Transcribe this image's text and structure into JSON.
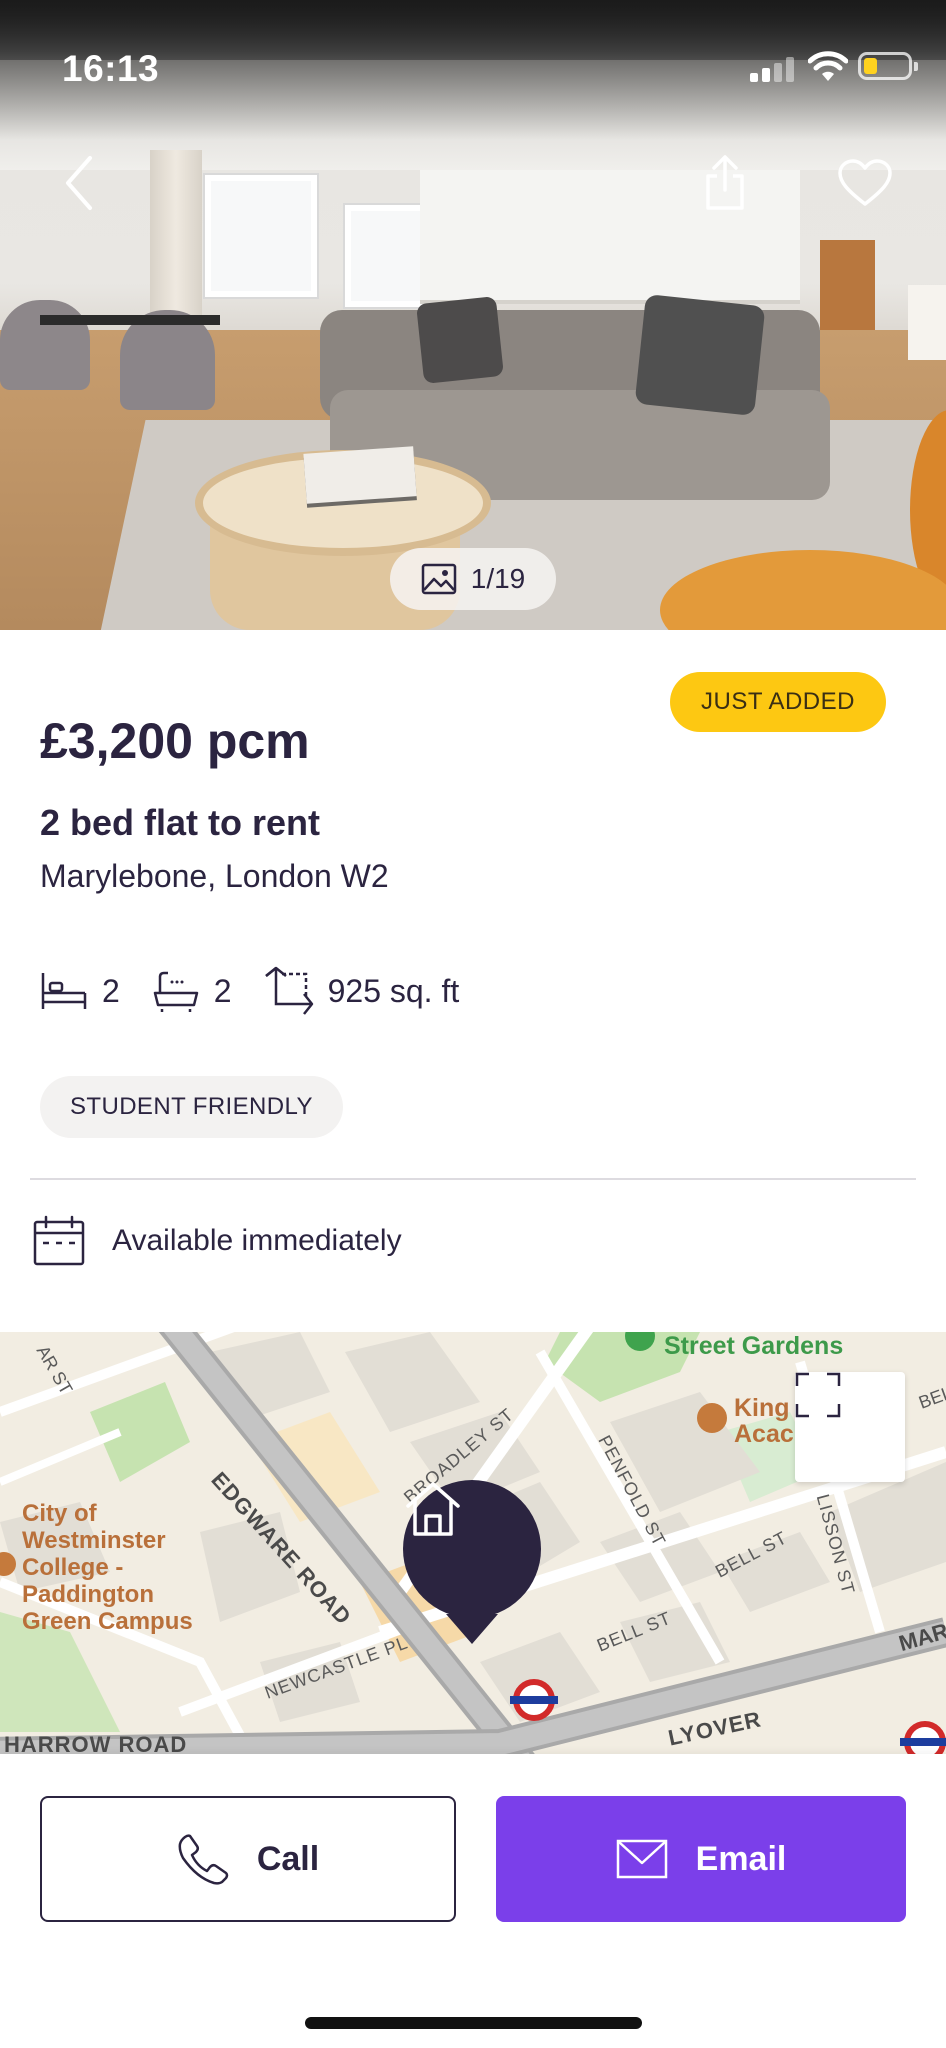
{
  "status_bar": {
    "time": "16:13"
  },
  "hero": {
    "photo_counter": "1/19"
  },
  "listing": {
    "badge": "JUST ADDED",
    "price": "£3,200 pcm",
    "property_type": "2 bed flat to rent",
    "address": "Marylebone, London W2",
    "bedrooms": "2",
    "bathrooms": "2",
    "size": "925 sq. ft",
    "tag": "STUDENT FRIENDLY",
    "availability": "Available immediately"
  },
  "map": {
    "labels": {
      "gardens": "Street Gardens",
      "school_1": "King",
      "school_2": "Acac",
      "college_1": "City of",
      "college_2": "Westminster",
      "college_3": "College -",
      "college_4": "Paddington",
      "college_5": "Green Campus",
      "edgware": "EDGWARE ROAD",
      "broadley": "BROADLEY ST",
      "penfold": "PENFOLD ST",
      "lisson": "LISSON ST",
      "bell_1": "BELL ST",
      "bell_2": "BELL ST",
      "bel": "BEL",
      "newcastle": "NEWCASTLE PL",
      "harrow": "HARROW ROAD",
      "flyover": "LYOVER",
      "ar_st": "AR ST",
      "mar": "MAR"
    }
  },
  "actions": {
    "call_label": "Call",
    "email_label": "Email"
  },
  "colors": {
    "primary": "#2b2440",
    "accent": "#7b3fea",
    "badge": "#fdc812"
  }
}
